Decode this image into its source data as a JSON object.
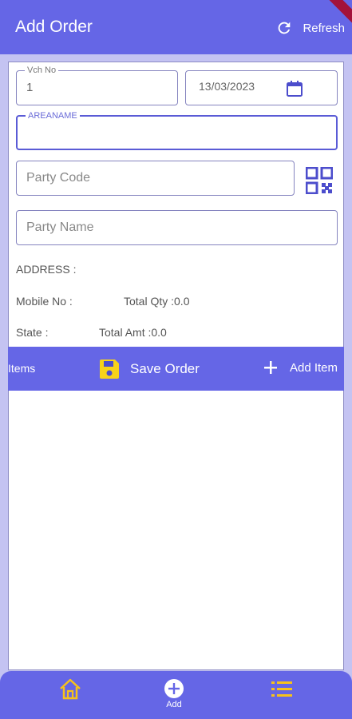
{
  "appbar": {
    "title": "Add Order",
    "refresh_label": "Refresh"
  },
  "form": {
    "vch_no": {
      "label": "Vch No",
      "value": "1"
    },
    "date": {
      "value": "13/03/2023"
    },
    "areaname": {
      "label": "AREANAME",
      "value": ""
    },
    "party_code": {
      "placeholder": "Party Code"
    },
    "party_name": {
      "placeholder": "Party Name"
    }
  },
  "info": {
    "address": "ADDRESS :",
    "mobile": "Mobile No :",
    "total_qty": "Total Qty :0.0",
    "state": "State :",
    "total_amt": "Total Amt :0.0"
  },
  "actionbar": {
    "items_label": "Items",
    "save_label": "Save Order",
    "add_item_label": "Add Item"
  },
  "bottomnav": {
    "add_label": "Add"
  },
  "colors": {
    "primary": "#6566e6",
    "background": "#c4c3f2",
    "accent_yellow": "#f7c21a"
  },
  "icons": [
    "refresh-icon",
    "calendar-icon",
    "qr-code-icon",
    "save-icon",
    "plus-icon",
    "home-icon",
    "add-circle-icon",
    "list-icon"
  ]
}
